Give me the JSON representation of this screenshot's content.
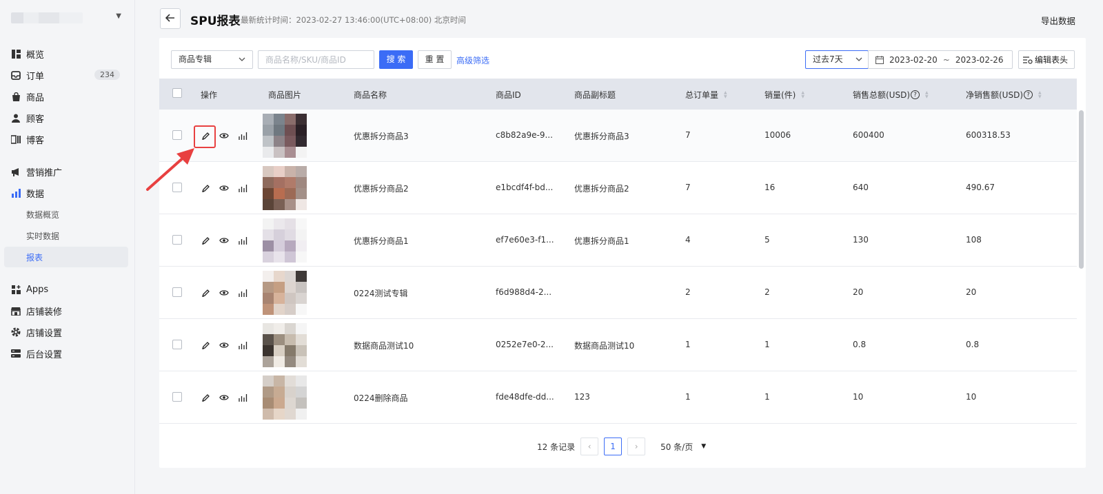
{
  "sidebar": {
    "items": [
      {
        "label": "概览",
        "icon": "dashboard-icon"
      },
      {
        "label": "订单",
        "icon": "inbox-icon",
        "badge": "234"
      },
      {
        "label": "商品",
        "icon": "bag-icon"
      },
      {
        "label": "顾客",
        "icon": "user-icon"
      },
      {
        "label": "博客",
        "icon": "blog-icon"
      },
      {
        "label": "营销推广",
        "icon": "megaphone-icon"
      },
      {
        "label": "数据",
        "icon": "bar-chart-icon"
      },
      {
        "label": "数据概览"
      },
      {
        "label": "实时数据"
      },
      {
        "label": "报表"
      },
      {
        "label": "Apps",
        "icon": "apps-icon"
      },
      {
        "label": "店铺装修",
        "icon": "store-icon"
      },
      {
        "label": "店铺设置",
        "icon": "gear-icon"
      },
      {
        "label": "后台设置",
        "icon": "server-icon"
      }
    ]
  },
  "header": {
    "title": "SPU报表",
    "stat_time": "最新统计时间：2023-02-27 13:46:00(UTC+08:00) 北京时间",
    "export": "导出数据"
  },
  "filters": {
    "field_select": "商品专辑",
    "search_placeholder": "商品名称/SKU/商品ID",
    "search_btn": "搜 索",
    "reset_btn": "重 置",
    "advanced": "高级筛选",
    "period": "过去7天",
    "date_start": "2023-02-20",
    "date_sep": "~",
    "date_end": "2023-02-26",
    "edit_header": "编辑表头"
  },
  "table": {
    "headers": {
      "action": "操作",
      "image": "商品图片",
      "name": "商品名称",
      "id": "商品ID",
      "subtitle": "商品副标题",
      "orders": "总订单量",
      "sales": "销量(件)",
      "total": "销售总额(USD)",
      "net": "净销售额(USD)"
    },
    "rows": [
      {
        "name": "优惠拆分商品3",
        "id": "c8b82a9e-9...",
        "subtitle": "优惠拆分商品3",
        "orders": "7",
        "sales": "10006",
        "total": "600400",
        "net": "600318.53"
      },
      {
        "name": "优惠拆分商品2",
        "id": "e1bcdf4f-bd...",
        "subtitle": "优惠拆分商品2",
        "orders": "7",
        "sales": "16",
        "total": "640",
        "net": "490.67"
      },
      {
        "name": "优惠拆分商品1",
        "id": "ef7e60e3-f1...",
        "subtitle": "优惠拆分商品1",
        "orders": "4",
        "sales": "5",
        "total": "130",
        "net": "108"
      },
      {
        "name": "0224测试专辑",
        "id": "f6d988d4-2...",
        "subtitle": "",
        "orders": "2",
        "sales": "2",
        "total": "20",
        "net": "20"
      },
      {
        "name": "数据商品测试10",
        "id": "0252e7e0-2...",
        "subtitle": "数据商品测试10",
        "orders": "1",
        "sales": "1",
        "total": "0.8",
        "net": "0.8"
      },
      {
        "name": "0224删除商品",
        "id": "fde48dfe-dd...",
        "subtitle": "123",
        "orders": "1",
        "sales": "1",
        "total": "10",
        "net": "10"
      }
    ]
  },
  "pagination": {
    "total": "12 条记录",
    "current": "1",
    "page_size": "50 条/页"
  },
  "colors": {
    "accent": "#3b6cf6",
    "highlight": "#e84040"
  }
}
